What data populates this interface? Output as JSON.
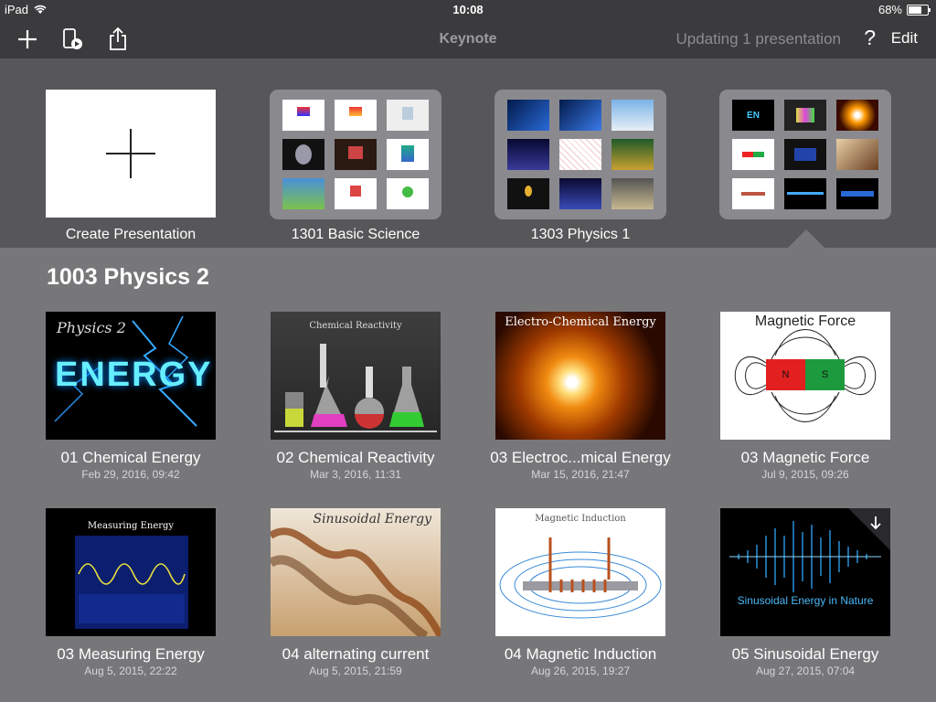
{
  "status_bar": {
    "device": "iPad",
    "time": "10:08",
    "battery": "68%",
    "battery_level": 0.68
  },
  "toolbar": {
    "title": "Keynote",
    "status": "Updating 1 presentation",
    "help": "?",
    "edit": "Edit",
    "icons": [
      "plus-icon",
      "keynote-remote-icon",
      "share-icon"
    ]
  },
  "folders": [
    {
      "name": "Create Presentation"
    },
    {
      "name": "1301 Basic Science"
    },
    {
      "name": "1303 Physics 1"
    },
    {
      "name": ""
    }
  ],
  "section": {
    "title": "1003 Physics 2"
  },
  "documents": [
    {
      "name": "01 Chemical Energy",
      "date": "Feb 29, 2016, 09:42",
      "thumb_title": "Physics 2",
      "thumb_big": "ENERGY"
    },
    {
      "name": "02 Chemical Reactivity",
      "date": "Mar 3, 2016, 11:31",
      "thumb_title": "Chemical Reactivity"
    },
    {
      "name": "03 Electroc...mical Energy",
      "date": "Mar 15, 2016, 21:47",
      "thumb_title": "Electro-Chemical Energy"
    },
    {
      "name": "03 Magnetic Force",
      "date": "Jul 9, 2015, 09:26",
      "thumb_title": "Magnetic Force",
      "n": "N",
      "s": "S"
    },
    {
      "name": "03 Measuring Energy",
      "date": "Aug 5, 2015, 22:22",
      "thumb_title": "Measuring Energy"
    },
    {
      "name": "04 alternating current",
      "date": "Aug 5, 2015, 21:59",
      "thumb_title": "Sinusoidal Energy"
    },
    {
      "name": "04 Magnetic Induction",
      "date": "Aug 26, 2015, 19:27",
      "thumb_title": "Magnetic Induction"
    },
    {
      "name": "05 Sinusoidal Energy",
      "date": "Aug 27, 2015, 07:04",
      "thumb_title": "Sinusoidal Energy in Nature"
    }
  ],
  "colors": {
    "toolbar_bg": "#3b3b3d",
    "folders_bg": "#575759",
    "content_bg": "#77777a"
  }
}
